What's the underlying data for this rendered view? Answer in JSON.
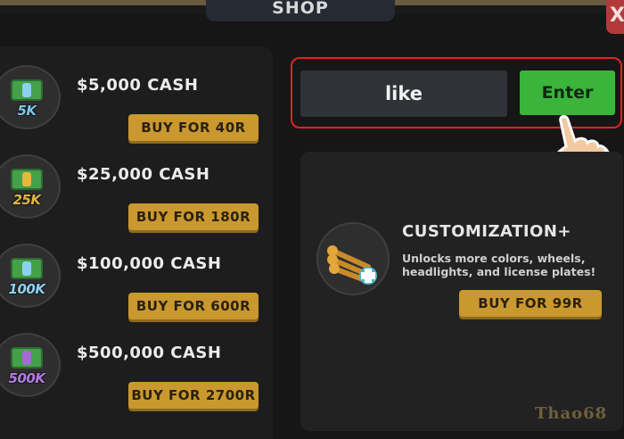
{
  "header": {
    "shop_label": "SHOP",
    "close_label": "X"
  },
  "cash_items": [
    {
      "title": "$5,000 CASH",
      "amount_label": "5K",
      "amount_color": "#7ec5e8",
      "band_color": "#8fd0f0",
      "buy_label": "BUY FOR 40R"
    },
    {
      "title": "$25,000 CASH",
      "amount_label": "25K",
      "amount_color": "#e2b447",
      "band_color": "#e6b83a",
      "buy_label": "BUY FOR 180R"
    },
    {
      "title": "$100,000 CASH",
      "amount_label": "100K",
      "amount_color": "#8fd0f0",
      "band_color": "#8fd0f0",
      "buy_label": "BUY FOR 600R"
    },
    {
      "title": "$500,000 CASH",
      "amount_label": "500K",
      "amount_color": "#b07ae0",
      "band_color": "#a46ad6",
      "buy_label": "BUY FOR 2700R"
    }
  ],
  "code_redeem": {
    "input_value": "like",
    "enter_label": "Enter"
  },
  "customization": {
    "title": "CUSTOMIZATION+",
    "description": "Unlocks more colors, wheels, headlights, and license plates!",
    "buy_label": "BUY FOR 99R"
  },
  "watermark": "Thao68",
  "colors": {
    "gold_button": "#c9982f",
    "green_button": "#3bb43b",
    "highlight_border": "#e02424",
    "panel": "#1d1d1d"
  }
}
